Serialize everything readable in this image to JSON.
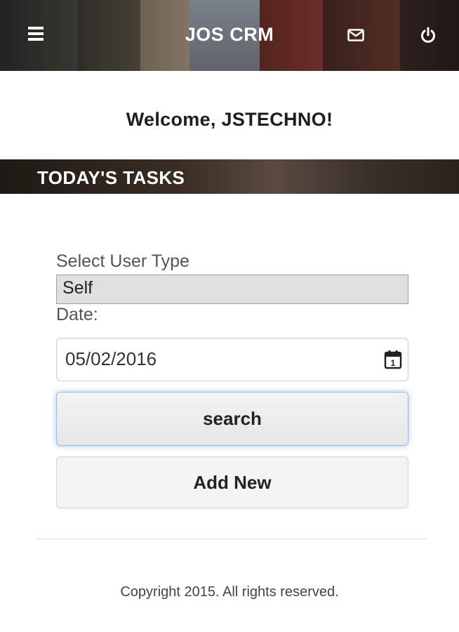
{
  "header": {
    "title": "JOS CRM",
    "menu_icon": "hamburger-menu-icon",
    "mail_icon": "mail-icon",
    "logout_icon": "power-icon"
  },
  "welcome_text": "Welcome, JSTECHNO!",
  "section_title": "TODAY'S TASKS",
  "form": {
    "user_type_label": "Select User Type",
    "user_type_value": "Self",
    "date_label": "Date:",
    "date_value": "05/02/2016",
    "calendar_icon": "calendar-icon",
    "calendar_day": "1"
  },
  "buttons": {
    "search_label": "search",
    "add_new_label": "Add New"
  },
  "footer": {
    "copyright": "Copyright 2015. All rights reserved."
  },
  "colors": {
    "header_text": "#ffffff",
    "search_focus_glow": "#5096e6",
    "select_bg": "#e0e0e0"
  }
}
